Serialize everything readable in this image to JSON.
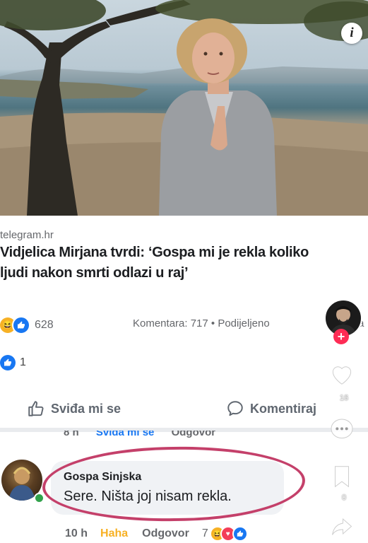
{
  "post": {
    "source": "telegram.hr",
    "headline": "Vidjelica Mirjana tvrdi: ‘Gospa mi je rekla koliko ljudi nakon smrti odlazi u raj’",
    "reaction_count": "628",
    "stats_text": "Komentara: 717 • Podijeljeno",
    "stats_overflow": "a",
    "shares_reaction_count": "1",
    "info_label": "i"
  },
  "actions": {
    "like_label": "Sviđa mi se",
    "comment_label": "Komentiraj"
  },
  "previous_comment_meta": {
    "time": "8 h",
    "like": "Sviđa mi se",
    "reply": "Odgovor"
  },
  "comment": {
    "author": "Gospa Sinjska",
    "text": "Sere. Ništa joj nisam rekla.",
    "time": "10 h",
    "reaction_label": "Haha",
    "reply_label": "Odgovor",
    "reaction_count": "7"
  },
  "overlay": {
    "like_count": "16",
    "comment_count": "0"
  },
  "colors": {
    "facebook_blue": "#1877f2",
    "haha_yellow": "#f7b125",
    "love_red": "#f33e58",
    "circle_mark": "#c4406a",
    "tiktok_red": "#fe2c55"
  }
}
